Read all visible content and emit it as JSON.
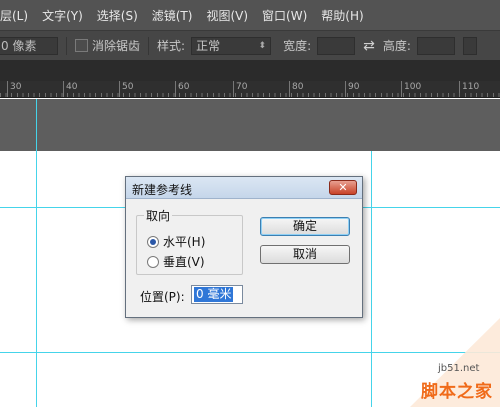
{
  "menubar": {
    "items": [
      "层(L)",
      "文字(Y)",
      "选择(S)",
      "滤镜(T)",
      "视图(V)",
      "窗口(W)",
      "帮助(H)"
    ]
  },
  "options_bar": {
    "feather_value": "0 像素",
    "antialias_label": "消除锯齿",
    "style_label": "样式:",
    "style_value": "正常",
    "width_label": "宽度:",
    "height_label": "高度:"
  },
  "ruler": {
    "labels": [
      "30",
      "40",
      "50",
      "60",
      "70",
      "80",
      "90",
      "100",
      "110"
    ]
  },
  "dialog": {
    "title": "新建参考线",
    "close_icon": "close-x-icon",
    "orientation_legend": "取向",
    "orientation_options": [
      "水平(H)",
      "垂直(V)"
    ],
    "selected_orientation": "水平(H)",
    "ok_label": "确定",
    "cancel_label": "取消",
    "position_label": "位置(P):",
    "position_value": "0 毫米"
  },
  "watermark": {
    "url": "jb51.net",
    "name": "脚本之家"
  },
  "colors": {
    "guide": "#45d4ea",
    "menubar_bg": "#535353",
    "dialog_selection": "#3077d7",
    "watermark_orange": "#f06b1a"
  }
}
